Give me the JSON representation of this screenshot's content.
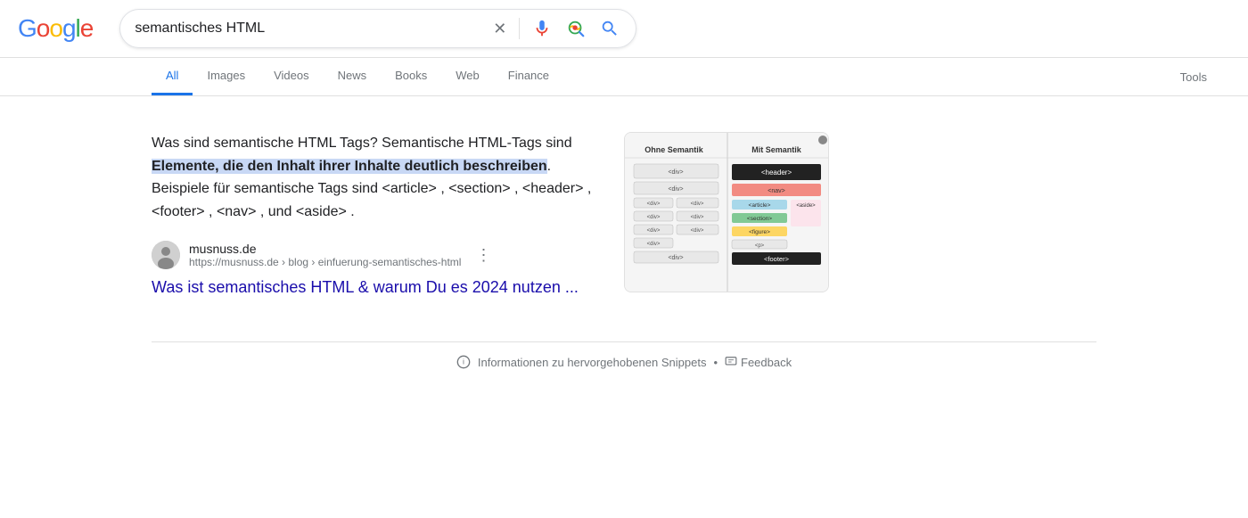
{
  "header": {
    "logo_text": "Google",
    "search_query": "semantisches HTML",
    "clear_label": "×",
    "search_button_label": "🔍"
  },
  "nav": {
    "tabs": [
      {
        "label": "All",
        "active": true
      },
      {
        "label": "Images",
        "active": false
      },
      {
        "label": "Videos",
        "active": false
      },
      {
        "label": "News",
        "active": false
      },
      {
        "label": "Books",
        "active": false
      },
      {
        "label": "Web",
        "active": false
      },
      {
        "label": "Finance",
        "active": false
      }
    ],
    "tools_label": "Tools"
  },
  "snippet": {
    "text_before": "Was sind semantische HTML Tags? Semantische HTML-Tags sind ",
    "text_highlighted": "Elemente, die den Inhalt ihrer Inhalte deutlich beschreiben",
    "text_after": ". Beispiele für semantische Tags sind <article> , <section> , <header> , <footer> , <nav> , und <aside> .",
    "image_alt": "Semantic HTML diagram"
  },
  "source": {
    "name": "musnuss.de",
    "url": "https://musnuss.de › blog › einfuerung-semantisches-html",
    "link_text": "Was ist semantisches HTML & warum Du es 2024 nutzen ..."
  },
  "footer": {
    "info_text": "Informationen zu hervorgehobenen Snippets",
    "feedback_label": "Feedback"
  },
  "colors": {
    "google_blue": "#4285F4",
    "google_red": "#EA4335",
    "google_yellow": "#FBBC05",
    "google_green": "#34A853",
    "link_color": "#1a0dab",
    "highlight_bg": "#c8d8f5",
    "active_tab": "#1a73e8"
  }
}
